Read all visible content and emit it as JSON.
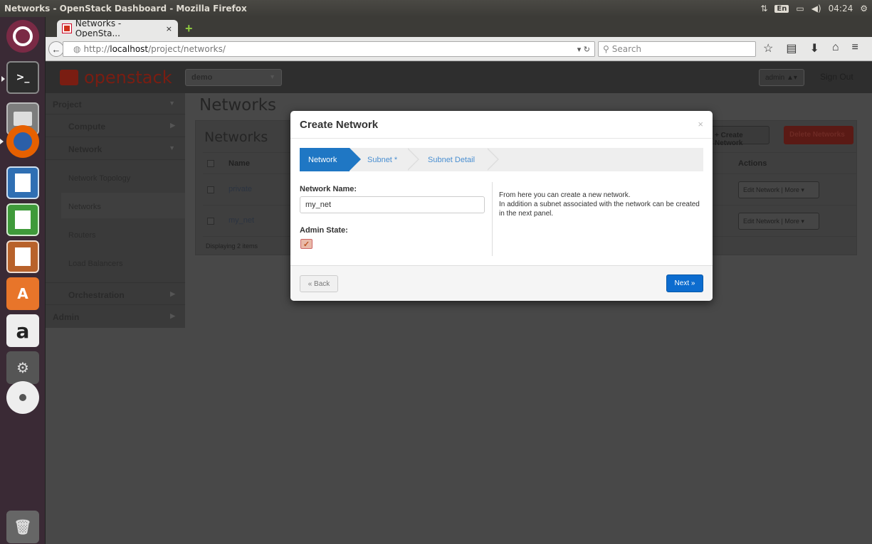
{
  "window": {
    "title": "Networks - OpenStack Dashboard - Mozilla Firefox"
  },
  "tray": {
    "keyboard": "En",
    "time": "04:24"
  },
  "browser": {
    "tab_title": "Networks - OpenSta...",
    "tab_close": "×",
    "new_tab": "+",
    "url_prefix": "http://",
    "url_host": "localhost",
    "url_path": "/project/networks/",
    "search_placeholder": "Search"
  },
  "launcher": {
    "items": [
      "ubuntu-dash",
      "terminal",
      "file-manager",
      "firefox",
      "writer",
      "calc",
      "impress",
      "software-center",
      "amazon",
      "system-settings",
      "dvd",
      "trash"
    ]
  },
  "header": {
    "logo": "openstack",
    "project_selector": "demo",
    "user_menu": "admin",
    "sign_out": "Sign Out"
  },
  "sidebar": {
    "project": "Project",
    "compute": "Compute",
    "network": "Network",
    "items": [
      "Network Topology",
      "Networks",
      "Routers",
      "Load Balancers"
    ],
    "orchestration": "Orchestration",
    "admin": "Admin"
  },
  "main": {
    "page_title": "Networks",
    "table_title": "Networks",
    "create_button": "+ Create Network",
    "delete_button": "Delete Networks",
    "columns": {
      "name": "Name",
      "actions": "Actions"
    },
    "rows": [
      {
        "name": "private",
        "edit": "Edit Network",
        "more": "More"
      },
      {
        "name": "my_net",
        "edit": "Edit Network",
        "more": "More"
      }
    ],
    "footer": "Displaying 2 items"
  },
  "modal": {
    "title": "Create Network",
    "close": "×",
    "steps": [
      "Network",
      "Subnet *",
      "Subnet Detail"
    ],
    "network_name_label": "Network Name:",
    "network_name_value": "my_net",
    "admin_state_label": "Admin State:",
    "admin_state_checked": true,
    "help_line1": "From here you can create a new network.",
    "help_line2": "In addition a subnet associated with the network can be created in the next panel.",
    "back_button": "« Back",
    "next_button": "Next »"
  },
  "colors": {
    "accent": "#1f77c4",
    "danger": "#8b1d13",
    "brand": "#7a1d12"
  }
}
